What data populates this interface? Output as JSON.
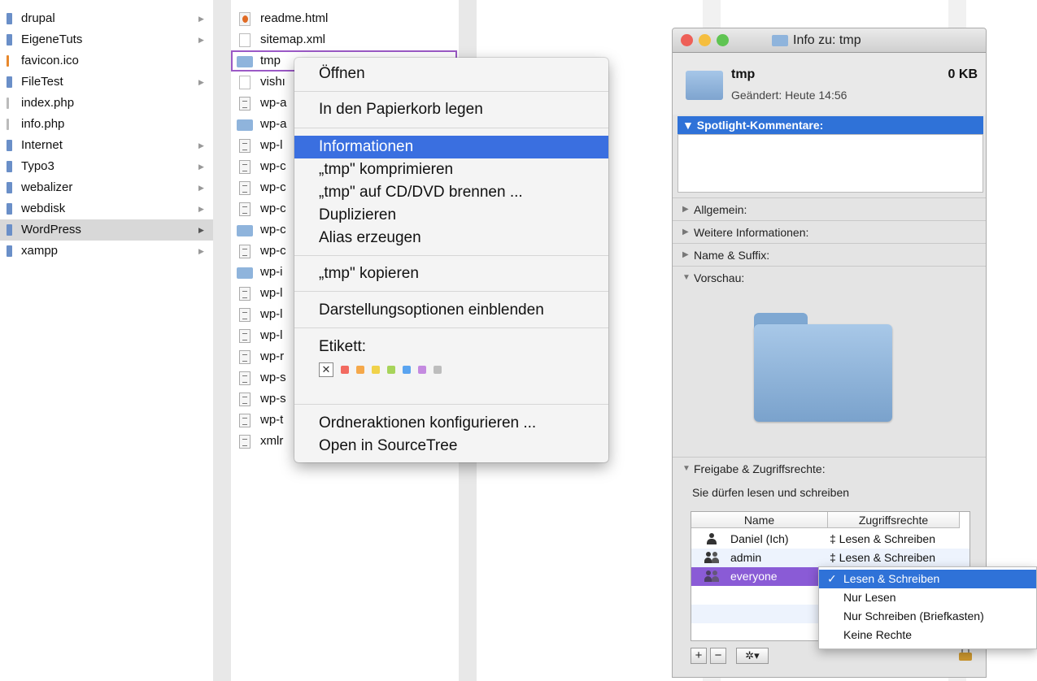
{
  "column1": {
    "items": [
      {
        "label": "drupal",
        "arrow": "▶"
      },
      {
        "label": "EigeneTuts",
        "arrow": "▶"
      },
      {
        "label": "favicon.ico",
        "arrow": ""
      },
      {
        "label": "FileTest",
        "arrow": "▶"
      },
      {
        "label": "index.php",
        "arrow": ""
      },
      {
        "label": "info.php",
        "arrow": ""
      },
      {
        "label": "Internet",
        "arrow": "▶"
      },
      {
        "label": "Typo3",
        "arrow": "▶"
      },
      {
        "label": "webalizer",
        "arrow": "▶"
      },
      {
        "label": "webdisk",
        "arrow": "▶"
      },
      {
        "label": "WordPress",
        "arrow": "▶"
      },
      {
        "label": "xampp",
        "arrow": "▶"
      }
    ]
  },
  "column2": {
    "items": [
      {
        "label": "readme.html"
      },
      {
        "label": "sitemap.xml"
      },
      {
        "label": "tmp"
      },
      {
        "label": "vishı"
      },
      {
        "label": "wp-a"
      },
      {
        "label": "wp-a"
      },
      {
        "label": "wp-l"
      },
      {
        "label": "wp-c"
      },
      {
        "label": "wp-c"
      },
      {
        "label": "wp-c"
      },
      {
        "label": "wp-c"
      },
      {
        "label": "wp-c"
      },
      {
        "label": "wp-i"
      },
      {
        "label": "wp-l"
      },
      {
        "label": "wp-l"
      },
      {
        "label": "wp-l"
      },
      {
        "label": "wp-r"
      },
      {
        "label": "wp-s"
      },
      {
        "label": "wp-s"
      },
      {
        "label": "wp-t"
      },
      {
        "label": "xmlr"
      }
    ]
  },
  "context_menu": {
    "open": "Öffnen",
    "trash": "In den Papierkorb legen",
    "info": "Informationen",
    "compress": "„tmp\" komprimieren",
    "burn": "„tmp\" auf CD/DVD brennen ...",
    "duplicate": "Duplizieren",
    "alias": "Alias erzeugen",
    "copy": "„tmp\" kopieren",
    "view_options": "Darstellungsoptionen einblenden",
    "label_heading": "Etikett:",
    "label_none": "✕",
    "label_colors": [
      "#f26a60",
      "#f5a84a",
      "#f0d24a",
      "#a7d45a",
      "#5aa4f0",
      "#c48ae0",
      "#bdbdbd"
    ],
    "folder_actions": "Ordneraktionen konfigurieren ...",
    "sourcetree": "Open in SourceTree"
  },
  "info_window": {
    "title": "Info zu: tmp",
    "traffic_lights": [
      "#ee5f57",
      "#f5be3f",
      "#5fc452"
    ],
    "name": "tmp",
    "size": "0 KB",
    "modified": "Geändert:  Heute 14:56",
    "spotlight": "▼ Spotlight-Kommentare:",
    "sections": {
      "general": "Allgemein:",
      "more_info": "Weitere Informationen:",
      "name_ext": "Name & Suffix:",
      "preview": "Vorschau:",
      "sharing": "Freigabe & Zugriffsrechte:"
    },
    "perm_summary": "Sie dürfen lesen und schreiben",
    "perm_table": {
      "col_name": "Name",
      "col_access": "Zugriffsrechte",
      "rows": [
        {
          "name": "Daniel (Ich)",
          "access": "‡ Lesen & Schreiben"
        },
        {
          "name": "admin",
          "access": "‡ Lesen & Schreiben"
        },
        {
          "name": "everyone",
          "access": ""
        }
      ]
    },
    "add": "+",
    "remove": "−",
    "gear": "✲▾"
  },
  "access_popup": {
    "check": "✓",
    "options": [
      "Lesen & Schreiben",
      "Nur Lesen",
      "Nur Schreiben (Briefkasten)",
      "Keine Rechte"
    ]
  }
}
